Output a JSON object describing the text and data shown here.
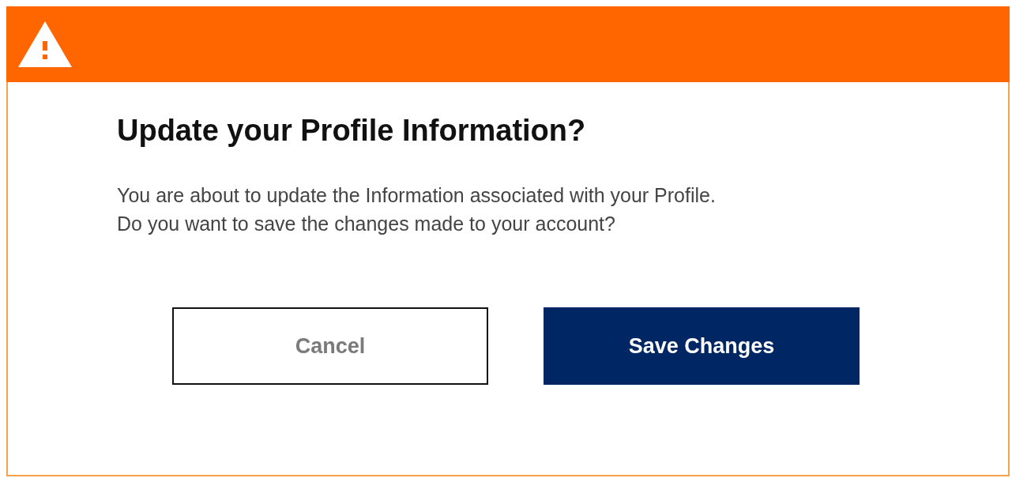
{
  "dialog": {
    "title": "Update your Profile Information?",
    "message": [
      "You are about to update the Information associated with your Profile.",
      "Do you want to save the changes made to your account?"
    ],
    "buttons": [
      {
        "label": "Cancel",
        "kind": "secondary"
      },
      {
        "label": "Save Changes",
        "kind": "primary"
      }
    ]
  }
}
